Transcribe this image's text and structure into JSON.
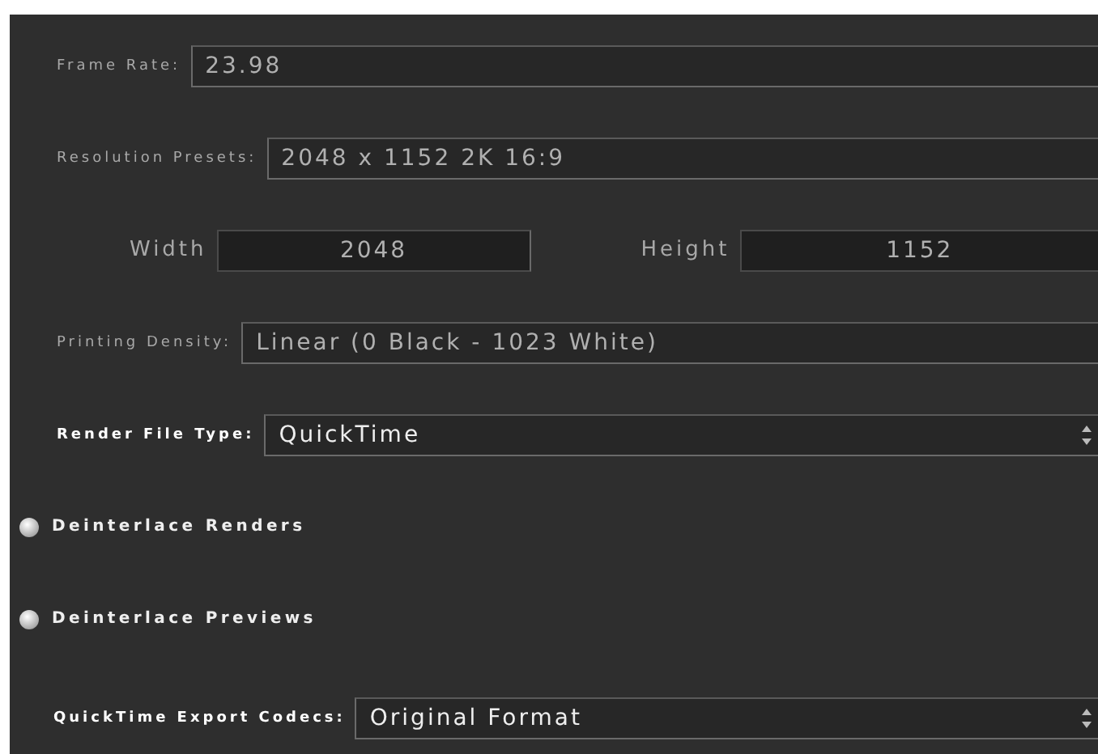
{
  "rows": [
    {
      "kind": "field",
      "label": "Frame Rate:",
      "value": "23.98",
      "disabled": true
    },
    {
      "kind": "field",
      "label": "Resolution Presets:",
      "value": "2048 x 1152 2K 16:9",
      "disabled": true
    },
    {
      "kind": "pair",
      "fields": [
        {
          "label": "Width",
          "value": "2048",
          "disabled": true
        },
        {
          "label": "Height",
          "value": "1152",
          "disabled": true
        }
      ]
    },
    {
      "kind": "field",
      "label": "Printing Density:",
      "value": "Linear (0 Black - 1023 White)",
      "disabled": true
    },
    {
      "kind": "dropdown",
      "label": "Render File Type:",
      "value": "QuickTime",
      "disabled": false
    },
    {
      "kind": "toggle",
      "label": "Deinterlace Renders",
      "checked": false
    },
    {
      "kind": "toggle",
      "label": "Deinterlace Previews",
      "checked": false
    },
    {
      "kind": "dropdown",
      "label": "QuickTime Export Codecs:",
      "value": "Original Format",
      "disabled": false
    }
  ]
}
